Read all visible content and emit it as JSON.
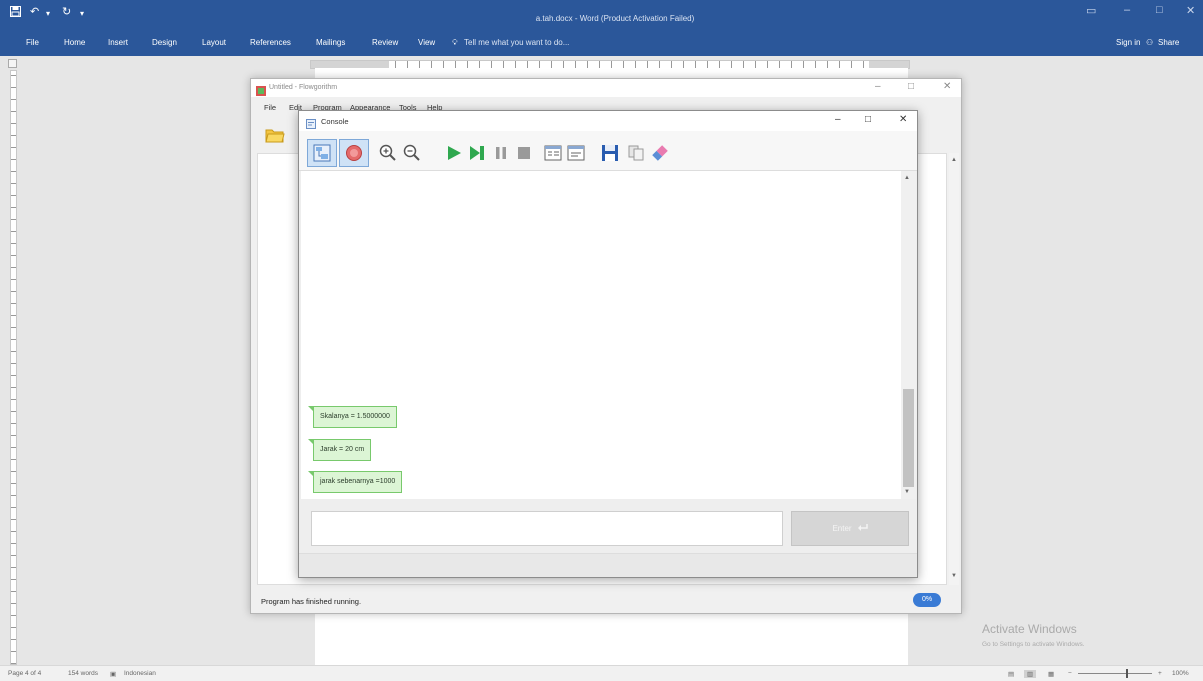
{
  "word": {
    "title": "a.tah.docx - Word (Product Activation Failed)",
    "tabs": [
      "File",
      "Home",
      "Insert",
      "Design",
      "Layout",
      "References",
      "Mailings",
      "Review",
      "View"
    ],
    "tell_me": "Tell me what you want to do...",
    "sign_in": "Sign in",
    "share": "Share",
    "status": {
      "page": "Page 4 of 4",
      "words": "154 words",
      "language": "Indonesian",
      "zoom": "100%"
    },
    "activate": {
      "title": "Activate Windows",
      "subtitle": "Go to Settings to activate Windows."
    }
  },
  "flowgorithm": {
    "title": "Untitled - Flowgorithm",
    "menu": [
      "File",
      "Edit",
      "Program",
      "Appearance",
      "Tools",
      "Help"
    ],
    "status": "Program has finished running.",
    "badge": "0%"
  },
  "console": {
    "title": "Console",
    "output": [
      "Skalanya = 1.5000000",
      "Jarak = 20 cm",
      "jarak sebenarnya =1000"
    ],
    "input_value": "",
    "enter_label": "Enter"
  },
  "icons": {
    "console_toolbar": [
      "flowchart-view-icon",
      "variable-watch-icon",
      "zoom-in-icon",
      "zoom-out-icon",
      "run-icon",
      "step-icon",
      "pause-icon",
      "stop-icon",
      "layout-panel-icon",
      "text-panel-icon",
      "save-icon",
      "copy-icon",
      "clear-icon"
    ],
    "flowgorithm_toolbar": [
      "open-folder-icon"
    ]
  },
  "colors": {
    "word_blue": "#2b579a",
    "bubble_fill": "#dcf5d5",
    "bubble_border": "#78c96c",
    "badge": "#3a7bd5",
    "run_green": "#2fa84f"
  }
}
